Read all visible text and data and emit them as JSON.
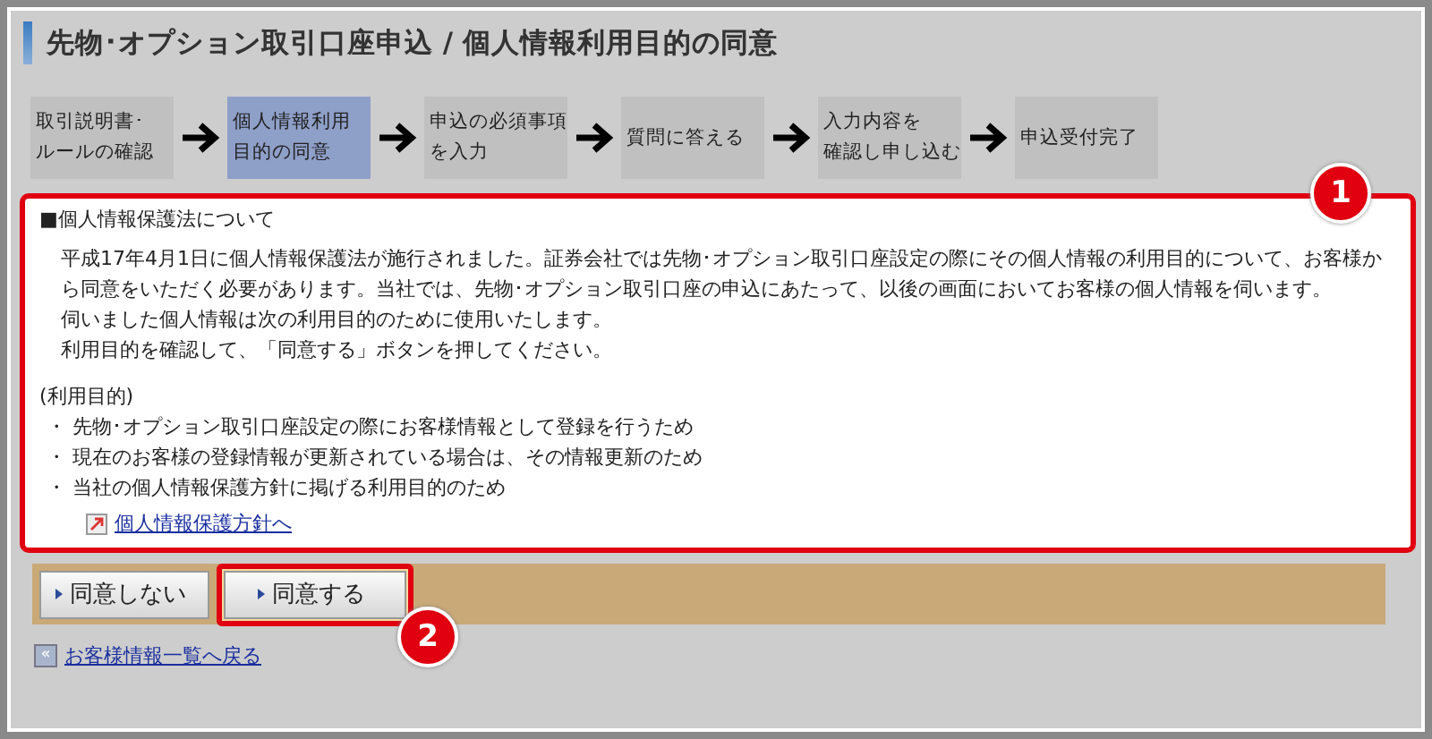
{
  "title": "先物･オプション取引口座申込 / 個人情報利用目的の同意",
  "steps": [
    {
      "lines": [
        "取引説明書･",
        "ルールの確認"
      ],
      "selected": false
    },
    {
      "lines": [
        "個人情報利用",
        "目的の同意"
      ],
      "selected": true
    },
    {
      "lines": [
        "申込の必須事項",
        "を入力"
      ],
      "selected": false
    },
    {
      "lines": [
        "質問に答える"
      ],
      "selected": false
    },
    {
      "lines": [
        "入力内容を",
        "確認し申し込む"
      ],
      "selected": false
    },
    {
      "lines": [
        "申込受付完了"
      ],
      "selected": false
    }
  ],
  "notice": {
    "heading": "■個人情報保護法について",
    "paragraphs": [
      "平成17年4月1日に個人情報保護法が施行されました。証券会社では先物･オプション取引口座設定の際にその個人情報の利用目的について、お客様から同意をいただく必要があります。当社では、先物･オプション取引口座の申込にあたって、以後の画面においてお客様の個人情報を伺います。",
      "伺いました個人情報は次の利用目的のために使用いたします。",
      "利用目的を確認して、「同意する」ボタンを押してください。"
    ],
    "purpose_heading": "(利用目的)",
    "purposes": [
      "・ 先物･オプション取引口座設定の際にお客様情報として登録を行うため",
      "・ 現在のお客様の登録情報が更新されている場合は、その情報更新のため",
      "・ 当社の個人情報保護方針に掲げる利用目的のため"
    ],
    "link": "個人情報保護方針へ",
    "callout": "1"
  },
  "buttons": [
    {
      "label": "同意しない"
    },
    {
      "label": "同意する",
      "callout": "2"
    }
  ],
  "back_icon": "«",
  "back_link": "お客様情報一覧へ戻る"
}
